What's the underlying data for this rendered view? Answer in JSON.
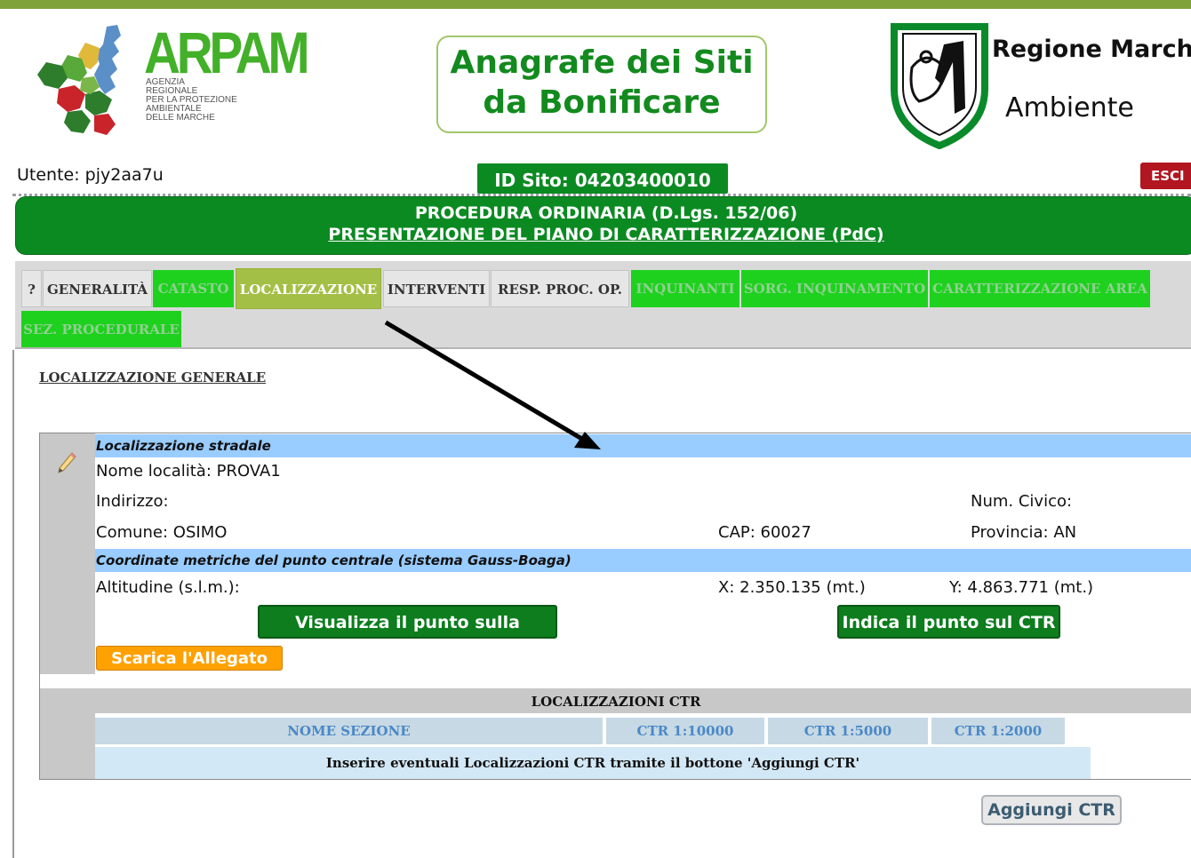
{
  "header": {
    "arpam_logo": {
      "word": "ARPAM",
      "subtitle_lines": [
        "AGENZIA",
        "REGIONALE",
        "PER LA PROTEZIONE",
        "AMBIENTALE",
        "DELLE MARCHE"
      ]
    },
    "title_line1": "Anagrafe dei Siti",
    "title_line2": "da Bonificare",
    "regione_name": "Regione Marche",
    "regione_sub": "Ambiente"
  },
  "user": {
    "label": "Utente: pjy2aa7u",
    "id_sito": "ID Sito: 04203400010",
    "logout": "ESCI"
  },
  "procedure": {
    "line1": "PROCEDURA ORDINARIA (D.Lgs. 152/06)",
    "line2": "PRESENTAZIONE DEL PIANO DI CARATTERIZZAZIONE (PdC)"
  },
  "tabs": [
    {
      "label": "?",
      "state": "grey"
    },
    {
      "label": "GENERALITÀ",
      "state": "grey"
    },
    {
      "label": "CATASTO",
      "state": "green"
    },
    {
      "label": "LOCALIZZAZIONE",
      "state": "active"
    },
    {
      "label": "INTERVENTI",
      "state": "grey"
    },
    {
      "label": "RESP. PROC. OP.",
      "state": "grey"
    },
    {
      "label": "INQUINANTI",
      "state": "green"
    },
    {
      "label": "SORG. INQUINAMENTO",
      "state": "green"
    },
    {
      "label": "CARATTERIZZAZIONE AREA",
      "state": "green"
    },
    {
      "label": "SEZ. PROCEDURALE",
      "state": "green"
    }
  ],
  "section_link": "LOCALIZZAZIONE GENERALE",
  "localizzazione": {
    "stradale_heading": "Localizzazione stradale",
    "nome_localita": "Nome località: PROVA1",
    "indirizzo": "Indirizzo:",
    "num_civico": "Num. Civico:",
    "comune": "Comune: OSIMO",
    "cap": "CAP: 60027",
    "provincia": "Provincia: AN",
    "coord_heading": "Coordinate metriche del punto centrale (sistema Gauss-Boaga)",
    "altitudine": "Altitudine (s.l.m.):",
    "x": "X: 2.350.135 (mt.)",
    "y": "Y: 4.863.771 (mt.)",
    "btn_mappa": "Visualizza il punto sulla MAPPA",
    "btn_ctr": "Indica il punto sul CTR",
    "btn_allegato": "Scarica l'Allegato"
  },
  "ctr": {
    "heading": "LOCALIZZAZIONI CTR",
    "columns": [
      "NOME SEZIONE",
      "CTR 1:10000",
      "CTR 1:5000",
      "CTR 1:2000"
    ],
    "empty_message": "Inserire eventuali Localizzazioni CTR tramite il bottone 'Aggiungi CTR'",
    "add_button": "Aggiungi CTR"
  },
  "colors": {
    "green_dark": "#0b8a22",
    "tab_green": "#1fd11f",
    "tab_active": "#a4bf46",
    "section_blue": "#99ccff",
    "logout_red": "#b21620",
    "orange": "#ffa100"
  }
}
